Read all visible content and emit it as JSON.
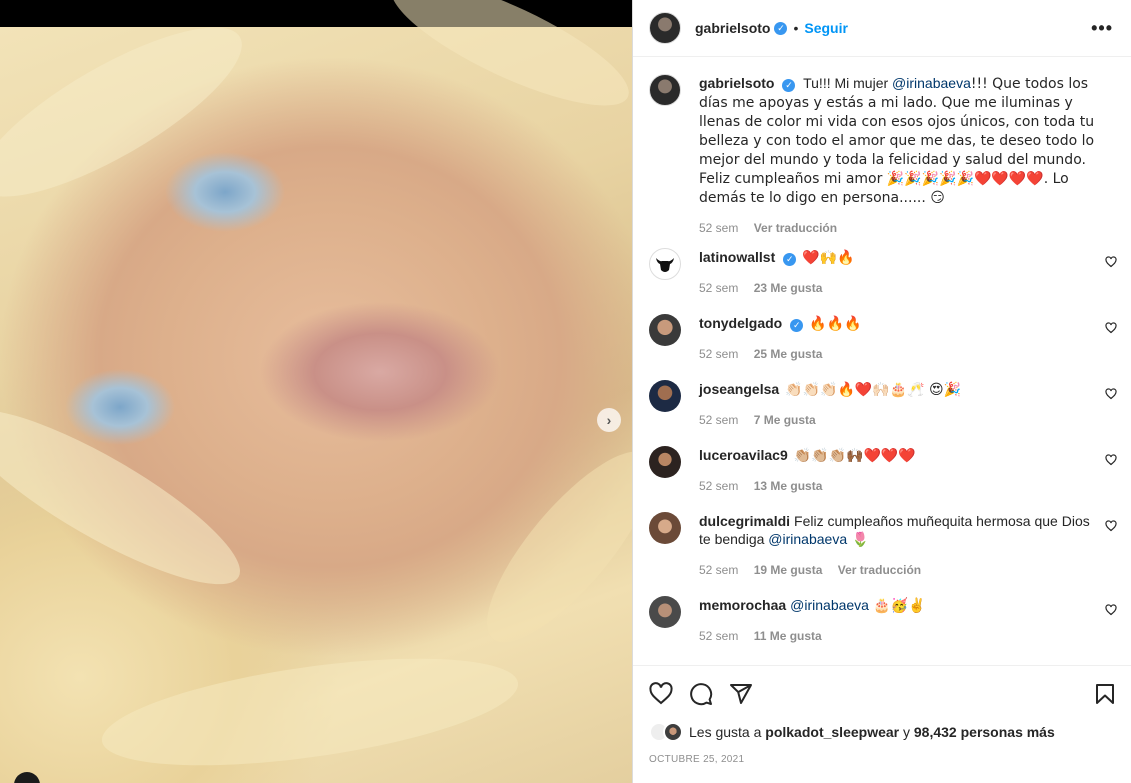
{
  "post": {
    "author": "gabrielsoto",
    "follow_label": "Seguir",
    "dot": "•",
    "more_label": "•••",
    "next_label": "›"
  },
  "caption": {
    "username": "gabrielsoto",
    "text_before": "Tu!!! Mi mujer ",
    "mention": "@irinabaeva",
    "text_after": "!!! Que todos los días me apoyas y estás a mi lado. Que me iluminas y llenas de color mi vida con esos ojos únicos, con toda tu belleza y con todo el amor que me das, te deseo todo lo mejor del mundo y toda la felicidad y salud del mundo. Feliz cumpleaños mi amor 🎉🎉🎉🎉🎉❤️❤️❤️❤️. Lo demás te lo digo en persona...... 😏",
    "time": "52 sem",
    "translate": "Ver traducción"
  },
  "comments": [
    {
      "username": "latinowallst",
      "text": "❤️🙌🔥",
      "time": "52 sem",
      "likes": "23 Me gusta"
    },
    {
      "username": "tonydelgado",
      "text": "🔥🔥🔥",
      "time": "52 sem",
      "likes": "25 Me gusta"
    },
    {
      "username": "joseangelsa",
      "text": "👏🏻👏🏻👏🏻🔥❤️🙌🏻🎂🥂 😍🎉",
      "time": "52 sem",
      "likes": "7 Me gusta"
    },
    {
      "username": "luceroavilac9",
      "text": "👏🏼👏🏼👏🏼🙌🏾❤️❤️❤️",
      "time": "52 sem",
      "likes": "13 Me gusta"
    },
    {
      "username": "dulcegrimaldi",
      "text_before": "Feliz cumpleaños muñequita hermosa que Dios te bendiga ",
      "mention": "@irinabaeva",
      "text_after": " 🌷",
      "time": "52 sem",
      "likes": "19 Me gusta",
      "translate": "Ver traducción"
    },
    {
      "username": "memorochaa",
      "mention": "@irinabaeva",
      "text_after": " 🎂🥳✌️",
      "time": "52 sem",
      "likes": "11 Me gusta"
    }
  ],
  "footer": {
    "likes_prefix": "Les gusta a ",
    "liker": "polkadot_sleepwear",
    "likes_mid": " y ",
    "likes_count": "98,432 personas más",
    "date": "OCTUBRE 25, 2021"
  },
  "icons": {
    "like": "heart-icon",
    "comment": "comment-icon",
    "share": "paper-plane-icon",
    "save": "bookmark-icon",
    "verified": "verified-badge-icon",
    "next": "chevron-right-icon"
  },
  "colors": {
    "accent": "#0095f6",
    "verified": "#3897f0",
    "muted": "#8e8e8e",
    "text": "#262626",
    "mention": "#00376b"
  }
}
